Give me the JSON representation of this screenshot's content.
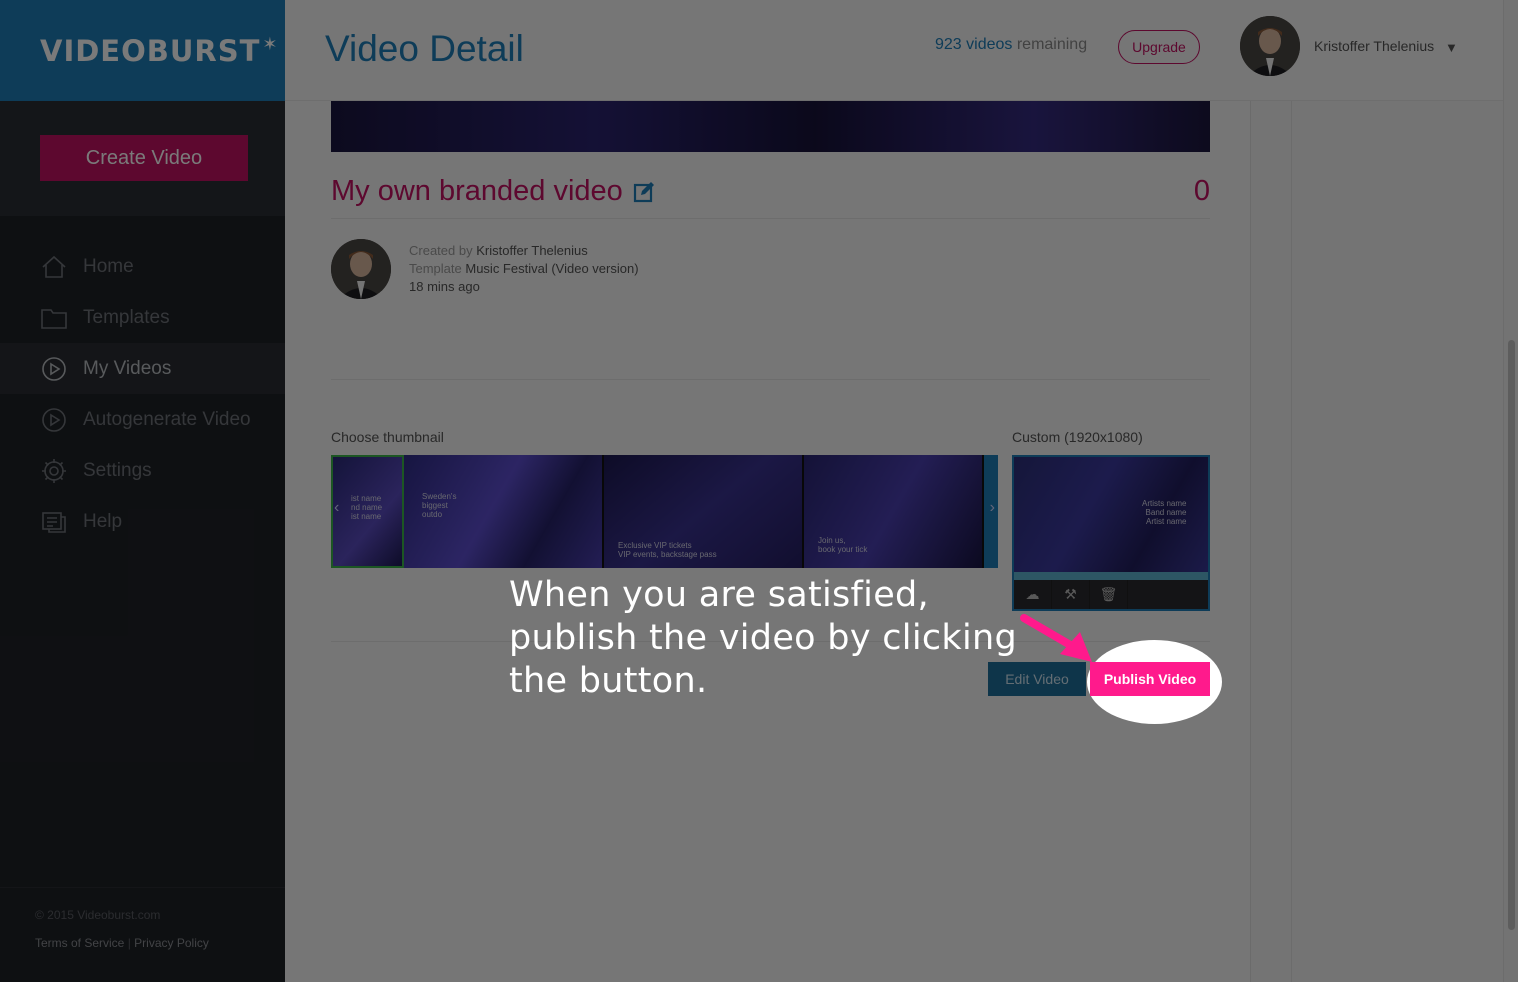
{
  "brand": {
    "logo_text": "VIDEOBURST",
    "accent": "#c21162",
    "blue": "#1f7db8"
  },
  "sidebar": {
    "create_label": "Create Video",
    "items": [
      {
        "label": "Home",
        "icon": "home-icon"
      },
      {
        "label": "Templates",
        "icon": "folder-icon"
      },
      {
        "label": "My Videos",
        "icon": "play-icon",
        "active": true
      },
      {
        "label": "Autogenerate Video",
        "icon": "play-icon"
      },
      {
        "label": "Settings",
        "icon": "gear-icon"
      },
      {
        "label": "Help",
        "icon": "help-icon"
      }
    ],
    "copyright": "© 2015 Videoburst.com",
    "terms": "Terms of Service",
    "privacy": "Privacy Policy",
    "separator": "|"
  },
  "header": {
    "title": "Video Detail",
    "remaining_count": "923 videos",
    "remaining_suffix": "remaining",
    "upgrade_label": "Upgrade",
    "user_name": "Kristoffer Thelenius"
  },
  "video": {
    "title": "My own branded video",
    "views": "0",
    "created_by_label": "Created by",
    "created_by": "Kristoffer Thelenius",
    "template_label": "Template",
    "template": "Music Festival (Video version)",
    "time_ago": "18 mins ago"
  },
  "thumbnails": {
    "choose_label": "Choose thumbnail",
    "custom_label": "Custom (1920x1080)",
    "items": [
      {
        "text": "ist name\nnd name\nist name"
      },
      {
        "text": "Sweden's\nbiggest\noutdo"
      },
      {
        "text": "Exclusive VIP tickets\nVIP events, backstage pass"
      },
      {
        "text": "Join us,\nbook your tick"
      }
    ],
    "custom_text": "Artists name\nBand name\nArtist name"
  },
  "actions": {
    "edit_label": "Edit Video",
    "publish_label": "Publish Video"
  },
  "tutorial": {
    "text": "When you are satisfied, publish the video by clicking the button."
  }
}
